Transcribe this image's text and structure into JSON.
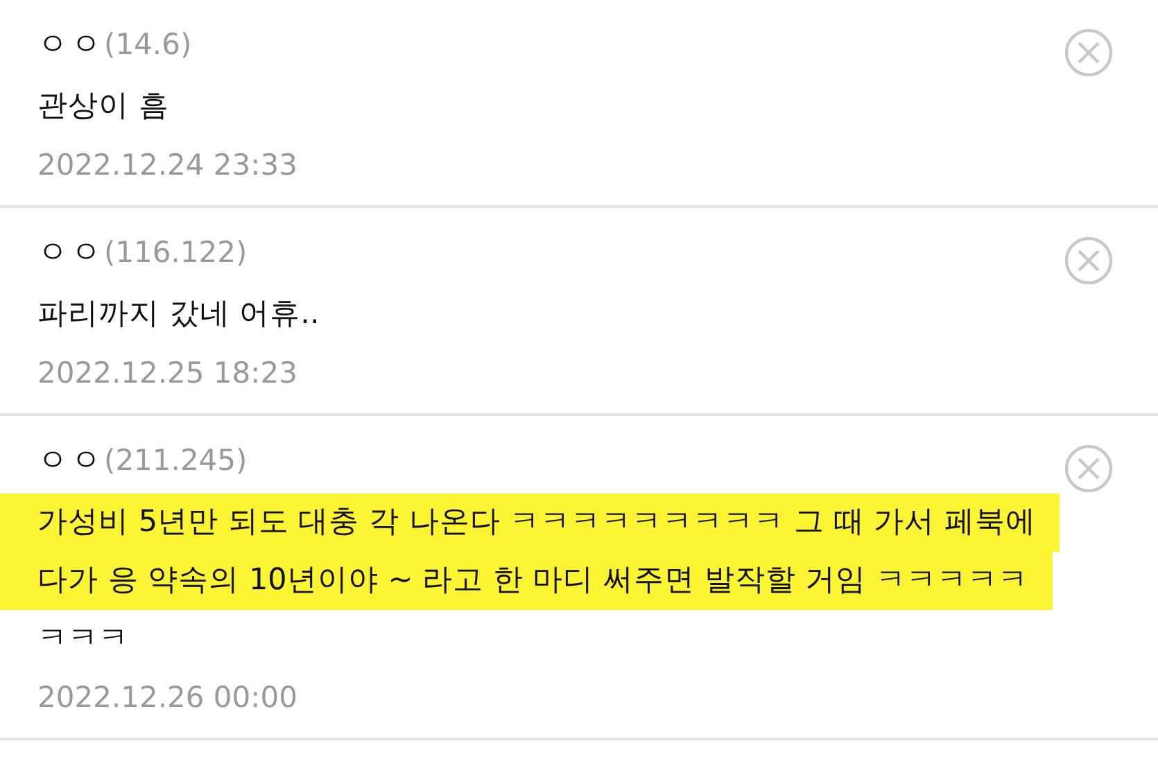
{
  "comments": [
    {
      "author": "ㅇㅇ",
      "ip": "(14.6)",
      "lines": [
        {
          "text": "관상이 흠",
          "highlighted": false
        }
      ],
      "date": "2022.12.24 23:33"
    },
    {
      "author": "ㅇㅇ",
      "ip": "(116.122)",
      "lines": [
        {
          "text": "파리까지 갔네 어휴..",
          "highlighted": false
        }
      ],
      "date": "2022.12.25 18:23"
    },
    {
      "author": "ㅇㅇ",
      "ip": "(211.245)",
      "lines": [
        {
          "text": "가성비 5년만 되도 대충 각 나온다 ㅋㅋㅋㅋㅋㅋㅋㅋㅋ 그 때 가서 페북에",
          "highlighted": true
        },
        {
          "text": "다가 응 약속의 10년이야 ~ 라고 한 마디 써주면 발작할 거임 ㅋㅋㅋㅋㅋ",
          "highlighted": true
        },
        {
          "text": "ㅋㅋㅋ",
          "highlighted": false
        }
      ],
      "date": "2022.12.26 00:00"
    }
  ]
}
